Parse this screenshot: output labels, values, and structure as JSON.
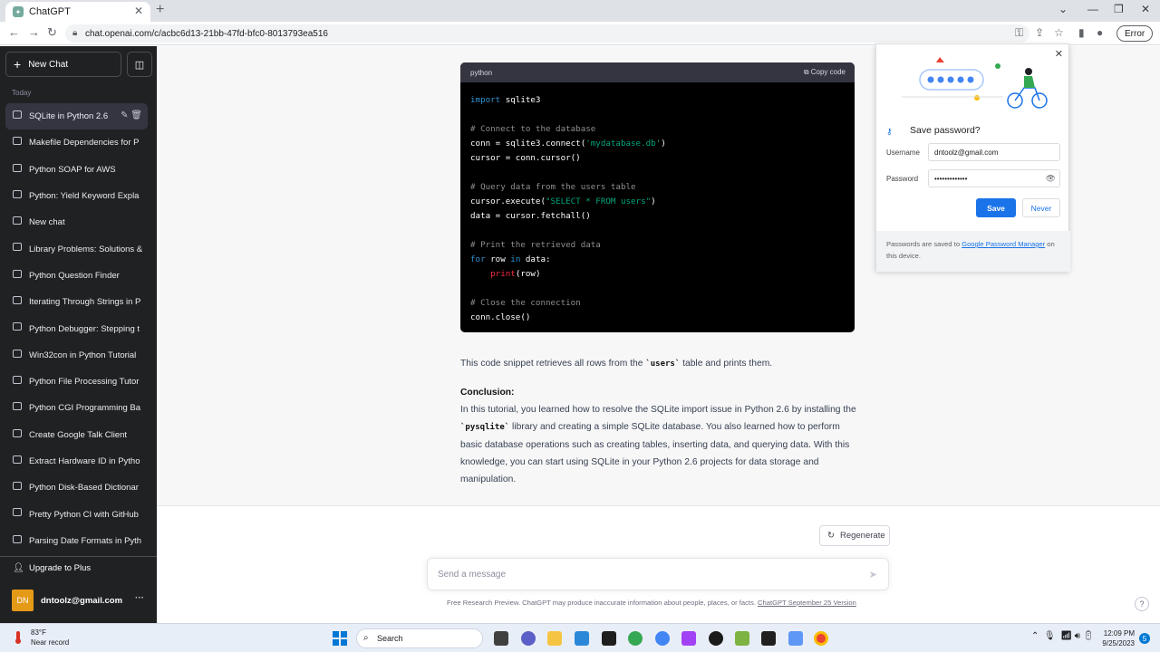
{
  "browser": {
    "tab_title": "ChatGPT",
    "url": "chat.openai.com/c/acbc6d13-21bb-47fd-bfc0-8013793ea516",
    "error_label": "Error"
  },
  "sidebar": {
    "new_chat_label": "New Chat",
    "section_label": "Today",
    "items": [
      {
        "label": "SQLite in Python 2.6"
      },
      {
        "label": "Makefile Dependencies for P"
      },
      {
        "label": "Python SOAP for AWS"
      },
      {
        "label": "Python: Yield Keyword Expla"
      },
      {
        "label": "New chat"
      },
      {
        "label": "Library Problems: Solutions &"
      },
      {
        "label": "Python Question Finder"
      },
      {
        "label": "Iterating Through Strings in P"
      },
      {
        "label": "Python Debugger: Stepping t"
      },
      {
        "label": "Win32con in Python Tutorial"
      },
      {
        "label": "Python File Processing Tutor"
      },
      {
        "label": "Python CGI Programming Ba"
      },
      {
        "label": "Create Google Talk Client"
      },
      {
        "label": "Extract Hardware ID in Pytho"
      },
      {
        "label": "Python Disk-Based Dictionar"
      },
      {
        "label": "Pretty Python CI with GitHub"
      },
      {
        "label": "Parsing Date Formats in Pyth"
      }
    ],
    "upgrade_label": "Upgrade to Plus",
    "avatar_initials": "DN",
    "account_email": "dntoolz@gmail.com"
  },
  "code": {
    "language": "python",
    "copy_label": "Copy code",
    "lines": [
      {
        "kw": "import",
        "rest": " sqlite3"
      },
      {
        "cm": ""
      },
      {
        "cm": "# Connect to the database"
      },
      {
        "pre": "conn = sqlite3.connect(",
        "str": "'mydatabase.db'",
        "post": ")"
      },
      {
        "pre": "cursor = conn.cursor()"
      },
      {
        "cm": ""
      },
      {
        "cm": "# Query data from the users table"
      },
      {
        "pre": "cursor.execute(",
        "str": "\"SELECT * FROM users\"",
        "post": ")"
      },
      {
        "pre": "data = cursor.fetchall()"
      },
      {
        "cm": ""
      },
      {
        "cm": "# Print the retrieved data"
      },
      {
        "kw": "for",
        "rest": " row ",
        "kw2": "in",
        "rest2": " data:"
      },
      {
        "pre": "    ",
        "fn": "print",
        "post": "(row)"
      },
      {
        "cm": ""
      },
      {
        "cm": "# Close the connection"
      },
      {
        "pre": "conn.close()"
      }
    ]
  },
  "answer": {
    "p1_before": "This code snippet retrieves all rows from the ",
    "p1_code": "`users`",
    "p1_after": " table and prints them.",
    "conclusion_heading": "Conclusion:",
    "p2_before": "In this tutorial, you learned how to resolve the SQLite import issue in Python 2.6 by installing the ",
    "p2_code": "`pysqlite`",
    "p2_after": " library and creating a simple SQLite database. You also learned how to perform basic database operations such as creating tables, inserting data, and querying data. With this knowledge, you can start using SQLite in your Python 2.6 projects for data storage and manipulation."
  },
  "composer": {
    "regenerate_label": "Regenerate",
    "placeholder": "Send a message",
    "footer_text": "Free Research Preview. ChatGPT may produce inaccurate information about people, places, or facts. ",
    "footer_link": "ChatGPT September 25 Version",
    "help_label": "?"
  },
  "password_popup": {
    "title": "Save password?",
    "username_label": "Username",
    "username_value": "dntoolz@gmail.com",
    "password_label": "Password",
    "password_value": "•••••••••••••",
    "save_label": "Save",
    "never_label": "Never",
    "note_before": "Passwords are saved to ",
    "note_link": "Google Password Manager",
    "note_after": " on this device."
  },
  "taskbar": {
    "temperature": "83°F",
    "weather_text": "Near record",
    "search_label": "Search",
    "time": "12:09 PM",
    "date": "9/25/2023",
    "notification_count": "5"
  },
  "colors": {
    "sidebar_bg": "#202123",
    "accent": "#1a73e8",
    "code_bg": "#000000"
  }
}
